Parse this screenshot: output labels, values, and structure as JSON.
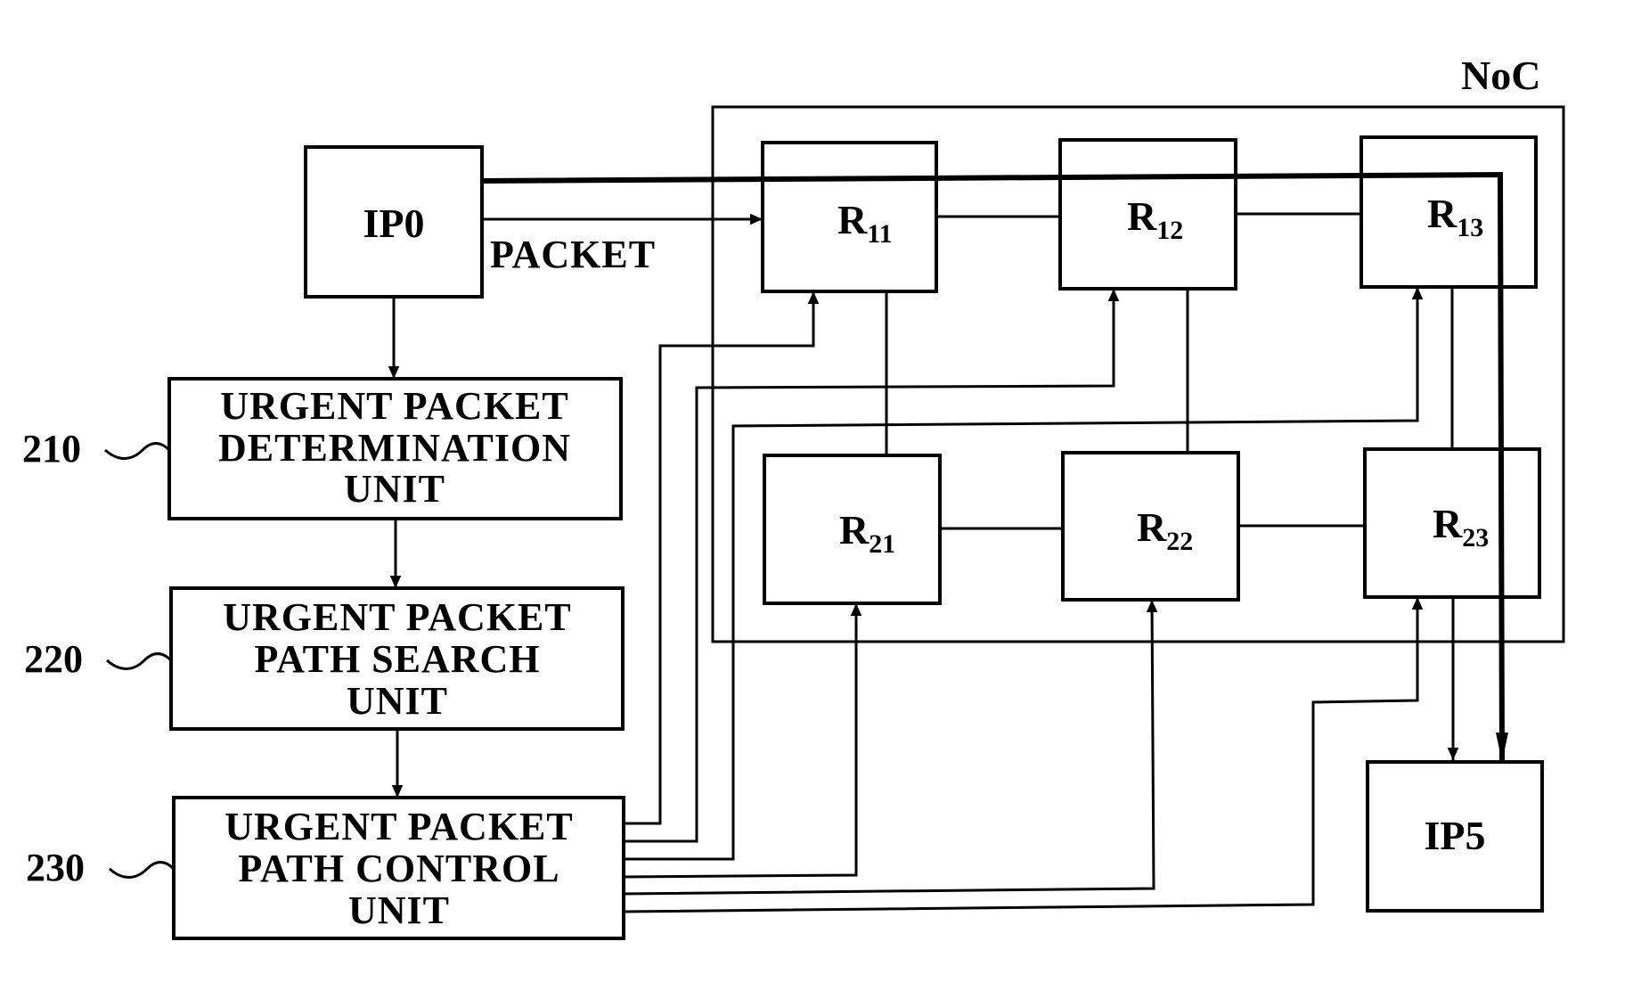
{
  "diagram": {
    "container_label": "NoC",
    "packet_label": "PACKET",
    "ip_blocks": [
      {
        "id": "ip0",
        "label": "IP0"
      },
      {
        "id": "ip5",
        "label": "IP5"
      }
    ],
    "units": [
      {
        "ref": "210",
        "lines": [
          "URGENT PACKET",
          "DETERMINATION",
          "UNIT"
        ]
      },
      {
        "ref": "220",
        "lines": [
          "URGENT PACKET",
          "PATH SEARCH",
          "UNIT"
        ]
      },
      {
        "ref": "230",
        "lines": [
          "URGENT PACKET",
          "PATH CONTROL",
          "UNIT"
        ]
      }
    ],
    "routers": [
      {
        "id": "R11",
        "base": "R",
        "sub": "11"
      },
      {
        "id": "R12",
        "base": "R",
        "sub": "12"
      },
      {
        "id": "R13",
        "base": "R",
        "sub": "13"
      },
      {
        "id": "R21",
        "base": "R",
        "sub": "21"
      },
      {
        "id": "R22",
        "base": "R",
        "sub": "22"
      },
      {
        "id": "R23",
        "base": "R",
        "sub": "23"
      }
    ],
    "connections": [
      {
        "from": "IP0",
        "to": "210",
        "type": "arrow"
      },
      {
        "from": "210",
        "to": "220",
        "type": "arrow"
      },
      {
        "from": "220",
        "to": "230",
        "type": "arrow"
      },
      {
        "from": "IP0",
        "to": "R11",
        "type": "arrow",
        "label": "PACKET"
      },
      {
        "from": "IP0",
        "to": "IP5",
        "type": "thick-path",
        "via": [
          "R11",
          "R12",
          "R13"
        ]
      },
      {
        "from": "R11",
        "to": "R12",
        "type": "link"
      },
      {
        "from": "R12",
        "to": "R13",
        "type": "link"
      },
      {
        "from": "R21",
        "to": "R22",
        "type": "link"
      },
      {
        "from": "R22",
        "to": "R23",
        "type": "link"
      },
      {
        "from": "R11",
        "to": "R21",
        "type": "link"
      },
      {
        "from": "R12",
        "to": "R22",
        "type": "link"
      },
      {
        "from": "R13",
        "to": "R23",
        "type": "link"
      },
      {
        "from": "R13",
        "to": "IP5",
        "type": "arrow"
      },
      {
        "from": "230",
        "to": "R11",
        "type": "control-arrow"
      },
      {
        "from": "230",
        "to": "R12",
        "type": "control-arrow"
      },
      {
        "from": "230",
        "to": "R13",
        "type": "control-arrow"
      },
      {
        "from": "230",
        "to": "R21",
        "type": "control-arrow"
      },
      {
        "from": "230",
        "to": "R22",
        "type": "control-arrow"
      },
      {
        "from": "230",
        "to": "R23",
        "type": "control-arrow"
      }
    ]
  }
}
